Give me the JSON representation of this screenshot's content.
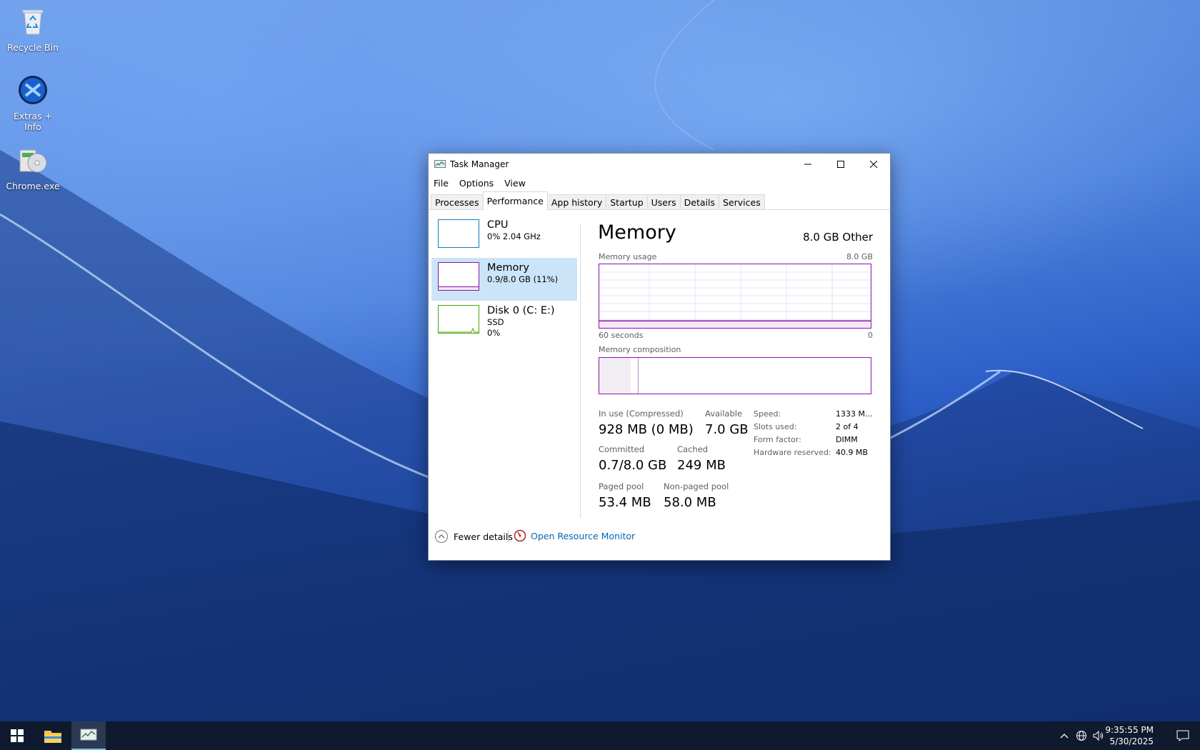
{
  "desktop": {
    "icons": [
      {
        "label": "Recycle Bin",
        "icon": "recycle-bin-icon"
      },
      {
        "label": "Extras + Info",
        "icon": "extras-info-icon"
      },
      {
        "label": "Chrome.exe",
        "icon": "installer-disc-icon"
      }
    ]
  },
  "window": {
    "title": "Task Manager",
    "menu": [
      "File",
      "Options",
      "View"
    ],
    "tabs": [
      "Processes",
      "Performance",
      "App history",
      "Startup",
      "Users",
      "Details",
      "Services"
    ],
    "active_tab": "Performance"
  },
  "resources": [
    {
      "name": "CPU",
      "line1": "0%  2.04 GHz",
      "line2": "",
      "color": "#117dbb"
    },
    {
      "name": "Memory",
      "line1": "0.9/8.0 GB (11%)",
      "line2": "",
      "color": "#8b12ae",
      "selected": true
    },
    {
      "name": "Disk 0 (C: E:)",
      "line1": "SSD",
      "line2": "0%",
      "color": "#4da60c"
    }
  ],
  "memory": {
    "title": "Memory",
    "type": "8.0 GB Other",
    "usage_label": "Memory usage",
    "usage_max": "8.0 GB",
    "axis_left": "60 seconds",
    "axis_right": "0",
    "usage_fraction": 0.11,
    "composition_label": "Memory composition",
    "stats": {
      "in_use_label": "In use (Compressed)",
      "in_use_value": "928 MB (0 MB)",
      "available_label": "Available",
      "available_value": "7.0 GB",
      "committed_label": "Committed",
      "committed_value": "0.7/8.0 GB",
      "cached_label": "Cached",
      "cached_value": "249 MB",
      "paged_label": "Paged pool",
      "paged_value": "53.4 MB",
      "nonpaged_label": "Non-paged pool",
      "nonpaged_value": "58.0 MB"
    },
    "specs": [
      {
        "k": "Speed:",
        "v": "1333 M..."
      },
      {
        "k": "Slots used:",
        "v": "2 of 4"
      },
      {
        "k": "Form factor:",
        "v": "DIMM"
      },
      {
        "k": "Hardware reserved:",
        "v": "40.9 MB"
      }
    ]
  },
  "footer": {
    "fewer_details": "Fewer details",
    "open_resource_monitor": "Open Resource Monitor"
  },
  "taskbar": {
    "time": "9:35:55 PM",
    "date": "5/30/2025"
  },
  "colors": {
    "accent_memory": "#8b12ae",
    "accent_cpu": "#117dbb",
    "accent_disk": "#4da60c",
    "selection": "#cce4f7",
    "link": "#0066b4"
  }
}
